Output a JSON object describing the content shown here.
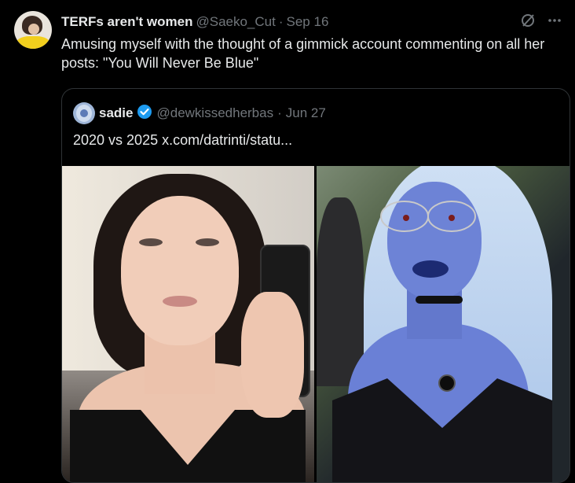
{
  "tweet": {
    "display_name": "TERFs aren't women",
    "handle": "@Saeko_Cut",
    "separator": "·",
    "date": "Sep 16",
    "text": "Amusing myself with the thought of a gimmick account commenting on all her posts: \"You Will Never Be Blue\""
  },
  "quoted": {
    "display_name": "sadie",
    "handle": "@dewkissedherbas",
    "separator": "·",
    "date": "Jun 27",
    "text": "2020 vs 2025  x.com/datrinti/statu..."
  },
  "icons": {
    "grok": "grok-icon",
    "more": "more-icon",
    "verified": "verified-badge-icon",
    "verified_color": "#1d9bf0"
  },
  "colors": {
    "background": "#000000",
    "text": "#e7e9ea",
    "muted": "#71767b",
    "border": "#2f3336"
  }
}
